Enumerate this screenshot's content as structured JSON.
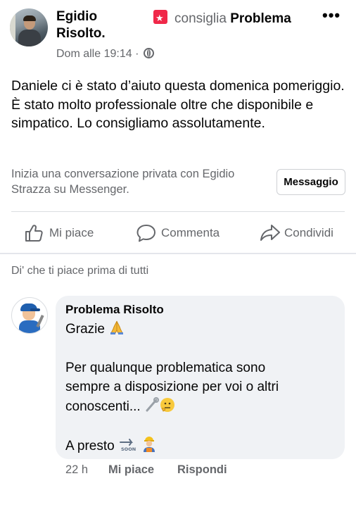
{
  "post": {
    "author": "Egidio Risolto.",
    "recommends_verb": "consiglia",
    "recommends_page": "Problema",
    "more_label": "•••",
    "timestamp": "Dom alle 19:14 ·",
    "text": "Daniele ci è stato d’aiuto questa domenica pomeriggio. È stato molto professionale oltre che disponibile e simpatico. Lo consigliamo assolutamente."
  },
  "messenger": {
    "prompt": "Inizia una conversazione privata con Egidio Strazza su Messenger.",
    "button_label": "Messaggio"
  },
  "actions": {
    "like": "Mi piace",
    "comment": "Commenta",
    "share": "Condividi"
  },
  "first_like_prompt": "Di' che ti piace prima di tutti",
  "comment": {
    "author": "Problema Risolto",
    "line1": "Grazie",
    "line2": "Per qualunque problematica sono",
    "line3": "sempre a disposizione per voi o altri",
    "line4": "conoscenti...",
    "line5": "A presto",
    "age": "22 h",
    "like": "Mi piace",
    "reply": "Rispondi"
  },
  "colors": {
    "text_primary": "#050505",
    "text_secondary": "#65676b",
    "recommend_icon": "#f02849",
    "bubble_bg": "#f0f2f5",
    "divider": "#dadde1"
  },
  "icons": [
    "recommend-icon",
    "more-icon",
    "globe-icon",
    "like-icon",
    "comment-icon",
    "share-icon",
    "folded-hands-emoji",
    "tools-emoji",
    "thinking-face-emoji",
    "soon-arrow-emoji",
    "worker-emoji"
  ]
}
